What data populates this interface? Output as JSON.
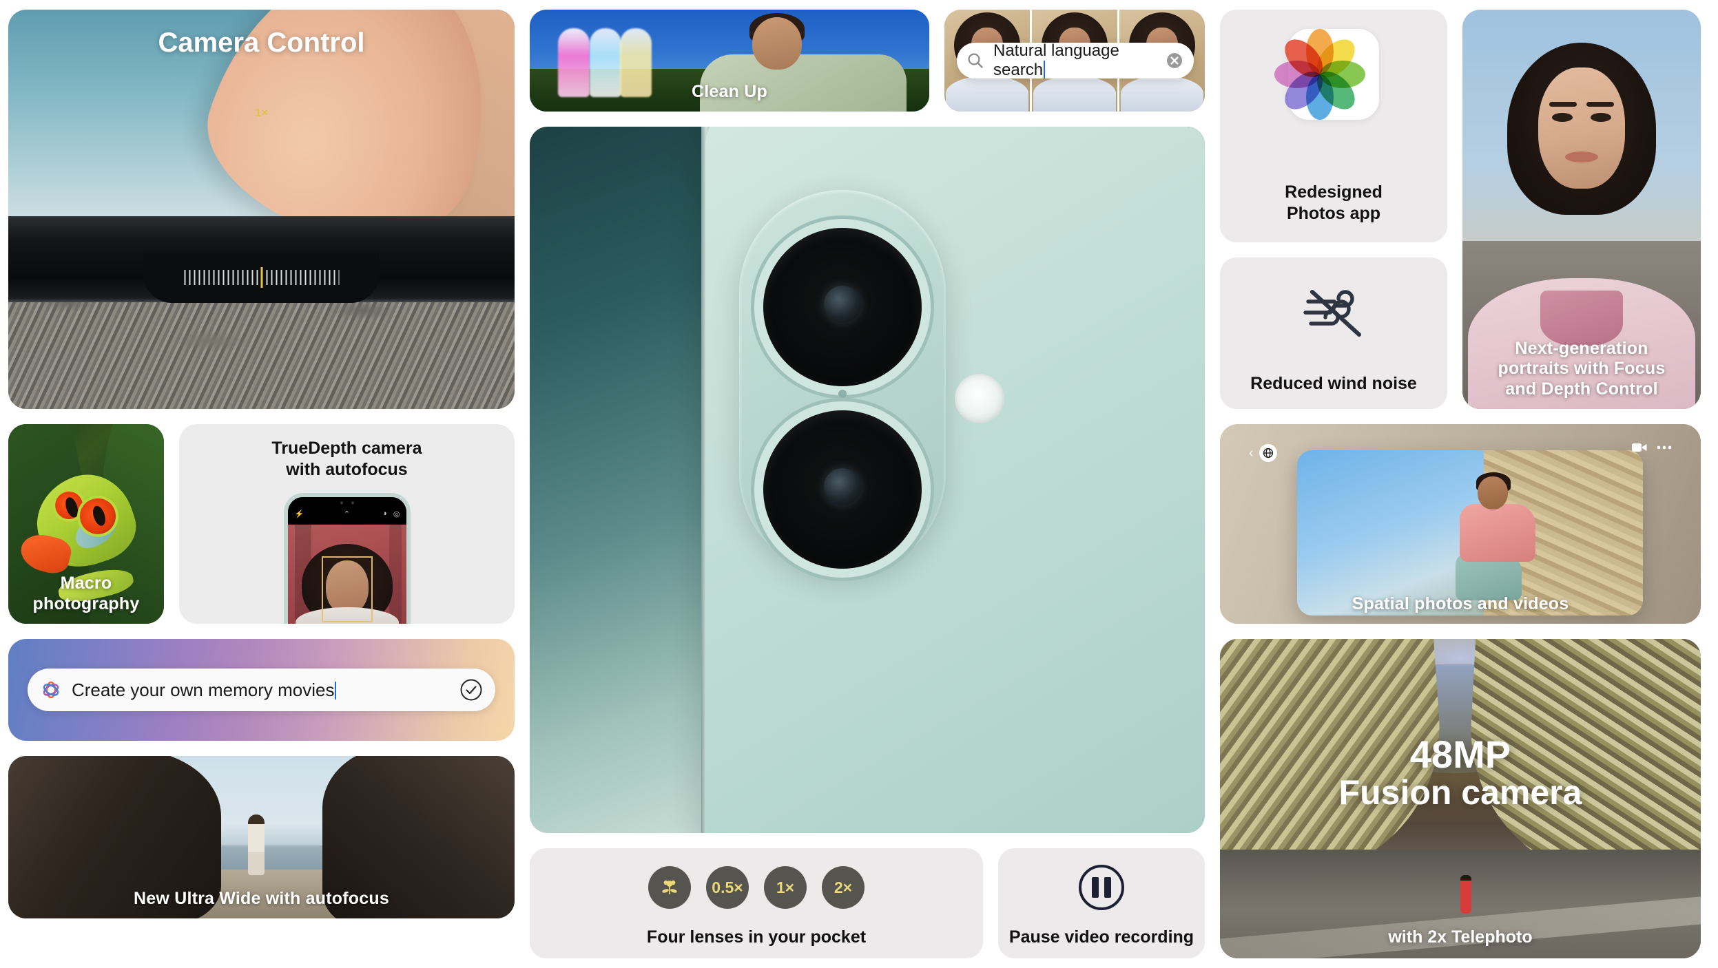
{
  "left_column": {
    "camera_control": {
      "title": "Camera Control",
      "zoom_indicator": "1×",
      "icon_name": "finger-tap-icon"
    },
    "macro": {
      "caption": "Macro photography"
    },
    "truedepth": {
      "title_line1": "TrueDepth camera",
      "title_line2": "with autofocus",
      "phone_icons": [
        "flash-icon",
        "chevron-up-icon",
        "filter-icon",
        "live-photo-icon"
      ]
    },
    "memory_movies": {
      "field_value": "Create your own memory movies",
      "left_icon_name": "apple-intelligence-icon",
      "right_icon_name": "check-circle-icon"
    },
    "ultra_wide": {
      "caption": "New Ultra Wide with autofocus"
    }
  },
  "center_column": {
    "clean_up": {
      "caption": "Clean Up"
    },
    "natural_language_search": {
      "search_icon_name": "search-icon",
      "search_value": "Natural language search",
      "clear_icon_name": "clear-circle-icon"
    },
    "hero": {
      "alt_name": "iphone-16-teal-rear-camera"
    },
    "lenses": {
      "caption": "Four lenses in your pocket",
      "buttons": [
        {
          "name": "macro-lens-button",
          "label": "",
          "icon": "flower-icon"
        },
        {
          "name": "ultrawide-lens-button",
          "label": "0.5×",
          "icon": ""
        },
        {
          "name": "wide-lens-button",
          "label": "1×",
          "icon": ""
        },
        {
          "name": "telephoto-lens-button",
          "label": "2×",
          "icon": ""
        }
      ],
      "button_color": "#56544f",
      "button_text_color": "#e9d778"
    },
    "pause": {
      "caption": "Pause video recording",
      "icon_name": "pause-circle-icon"
    }
  },
  "right_column": {
    "photos_app": {
      "label_line1": "Redesigned",
      "label_line2": "Photos app",
      "icon_name": "photos-app-icon"
    },
    "wind_noise": {
      "label": "Reduced wind noise",
      "icon_name": "wind-slash-icon"
    },
    "portrait": {
      "caption_line1": "Next-generation",
      "caption_line2": "portraits with Focus",
      "caption_line3": "and Depth Control"
    },
    "spatial": {
      "caption": "Spatial photos and videos",
      "back_icon_name": "chevron-left-icon",
      "immersive_icon_name": "spatial-badge-icon",
      "video_icon_name": "video-icon",
      "more_icon_name": "more-dots-icon"
    },
    "fusion": {
      "headline_line1": "48MP",
      "headline_line2": "Fusion camera",
      "subline": "with 2x Telephoto"
    }
  },
  "colors": {
    "tile_gray": "#ececec",
    "accent_yellow": "#e9d778",
    "dark_button": "#56544f",
    "caret_blue": "#1a6ce0",
    "page_background": "#ffffff"
  }
}
